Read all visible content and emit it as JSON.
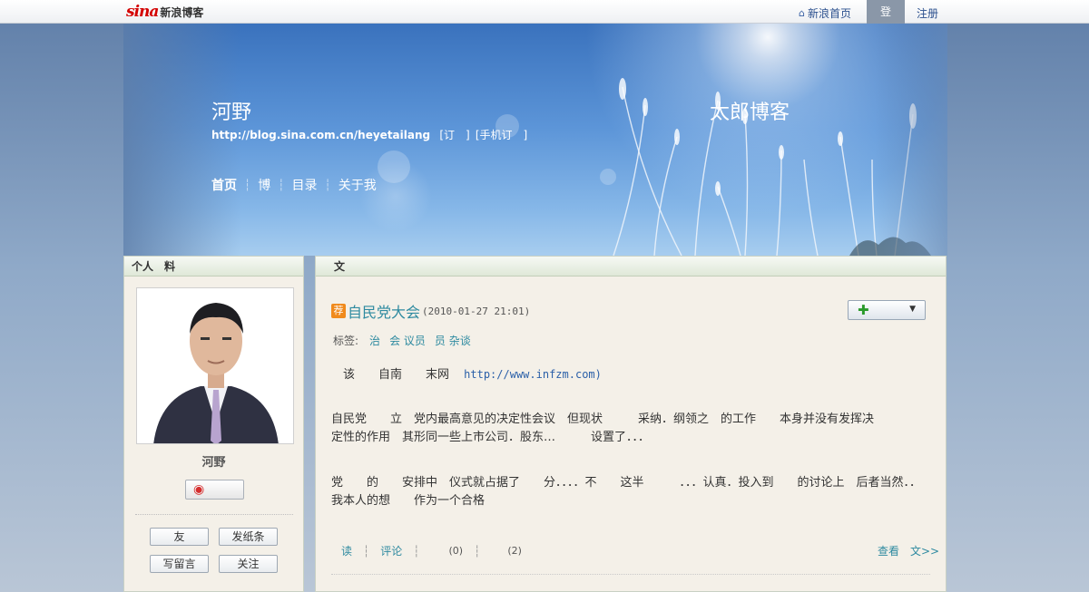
{
  "topbar": {
    "logo_text": "sina",
    "logo_sub": "新浪博客",
    "home_label": "新浪首页",
    "login_label": "登",
    "register_label": "注册"
  },
  "banner": {
    "blog_name": "河野",
    "blog_url": "http://blog.sina.com.cn/heyetailang",
    "subscribe": "[订　]",
    "mobile_subscribe": "[手机订　]",
    "blog_title": "太郎博客",
    "nav": [
      "首页",
      "博",
      "目录",
      "关于我"
    ]
  },
  "sidebar": {
    "title": "个人　料",
    "owner_name": "河野　",
    "buttons": [
      "友",
      "发纸条",
      "写留言",
      "关注"
    ]
  },
  "main": {
    "title": "文",
    "post": {
      "badge": "荐",
      "title": "自民党大会",
      "date": "(2010-01-27 21:01)",
      "tags_label": "标签:",
      "tags": [
        "治",
        "会 议员",
        "员 杂谈"
      ],
      "para1_text": "该　　自南　　末网",
      "para1_link": "http://www.infzm.com)",
      "para2_line1": "自民党　　立　党内最高意见的决定性会议　但现状　　　采纳．纲领之　的工作　　本身并没有发挥决",
      "para2_line2": "定性的作用　其形同一些上市公司．股东…　　　设置了．．．",
      "para3_line1": "党　　的　　安排中　仪式就占据了　　分．．．．不　　这半　　　．．．认真．投入到　　的讨论上　后者当然．．",
      "para3_line2": "我本人的想　　作为一个合格",
      "actions": {
        "read": "读",
        "comment": "评论",
        "count1": "(0)",
        "count2": "(2)",
        "readmore": "查看　文>>"
      }
    }
  },
  "colors": {
    "link_teal": "#2e8aa0",
    "badge_orange": "#f08a1c",
    "panel_bg": "#f4f0e8"
  }
}
